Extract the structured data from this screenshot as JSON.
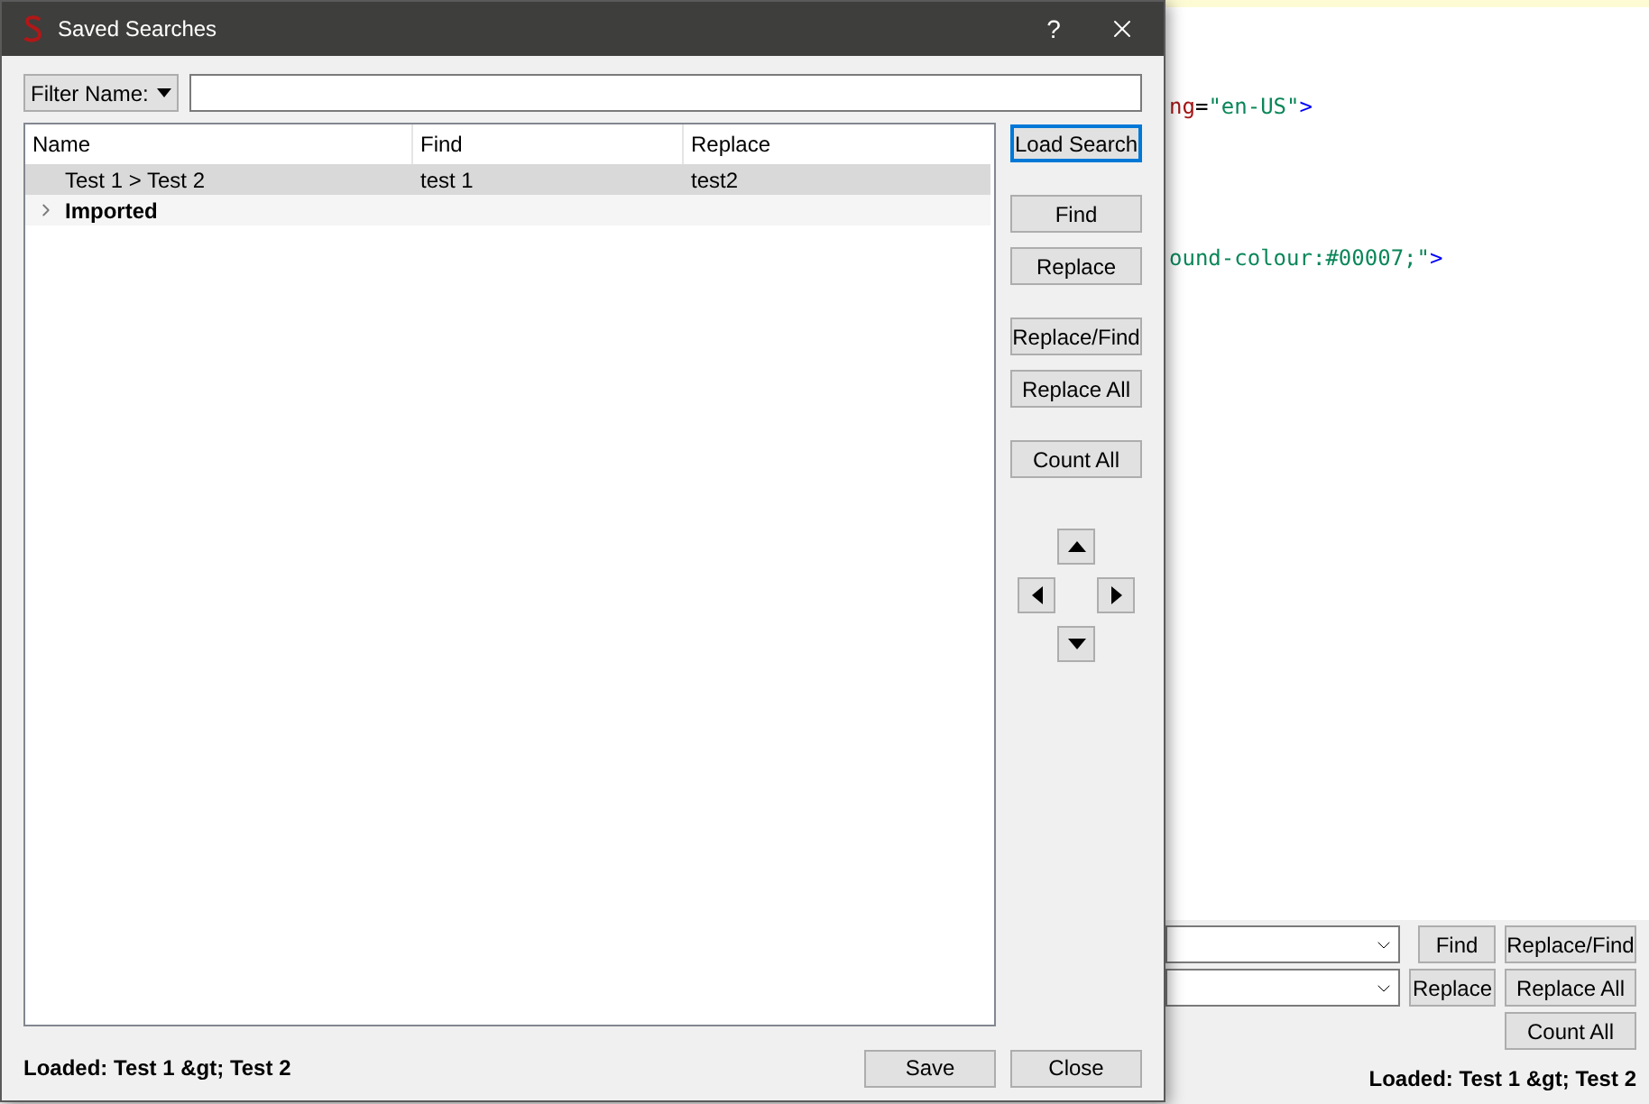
{
  "editor": {
    "lines": [
      {
        "segments": [
          {
            "text": "ng",
            "kind": "attr"
          },
          {
            "text": "=",
            "kind": "plain"
          },
          {
            "text": "\"en-US\"",
            "kind": "value"
          },
          {
            "text": ">",
            "kind": "tag"
          }
        ]
      },
      {
        "segments": [
          {
            "text": "ound-colour:#00007;\"",
            "kind": "value"
          },
          {
            "text": ">",
            "kind": "tag"
          }
        ]
      }
    ],
    "find_panel": {
      "rows": [
        [
          {
            "label": "Find"
          },
          {
            "label": "Replace/Find"
          }
        ],
        [
          {
            "label": "Replace"
          },
          {
            "label": "Replace All"
          }
        ],
        [
          null,
          {
            "label": "Count All"
          }
        ]
      ],
      "status": "Loaded: Test 1 &gt; Test 2"
    }
  },
  "dialog": {
    "title": "Saved Searches",
    "help": "?",
    "filter": {
      "label": "Filter Name:"
    },
    "tree": {
      "columns": [
        "Name",
        "Find",
        "Replace"
      ],
      "rows": [
        {
          "kind": "item",
          "name": "Test 1 > Test 2",
          "find": "test 1",
          "replace": "test2",
          "selected": true
        },
        {
          "kind": "folder",
          "name": "Imported",
          "expanded": false,
          "selected": false
        }
      ]
    },
    "side_button_groups": [
      [
        {
          "label": "Load Search",
          "focused": true
        }
      ],
      [
        {
          "label": "Find",
          "focused": false
        },
        {
          "label": "Replace",
          "focused": false
        }
      ],
      [
        {
          "label": "Replace/Find",
          "focused": false
        },
        {
          "label": "Replace All",
          "focused": false
        }
      ],
      [
        {
          "label": "Count All",
          "focused": false
        }
      ]
    ],
    "status": "Loaded: Test 1 &gt; Test 2",
    "buttons": [
      "Save",
      "Close"
    ]
  }
}
